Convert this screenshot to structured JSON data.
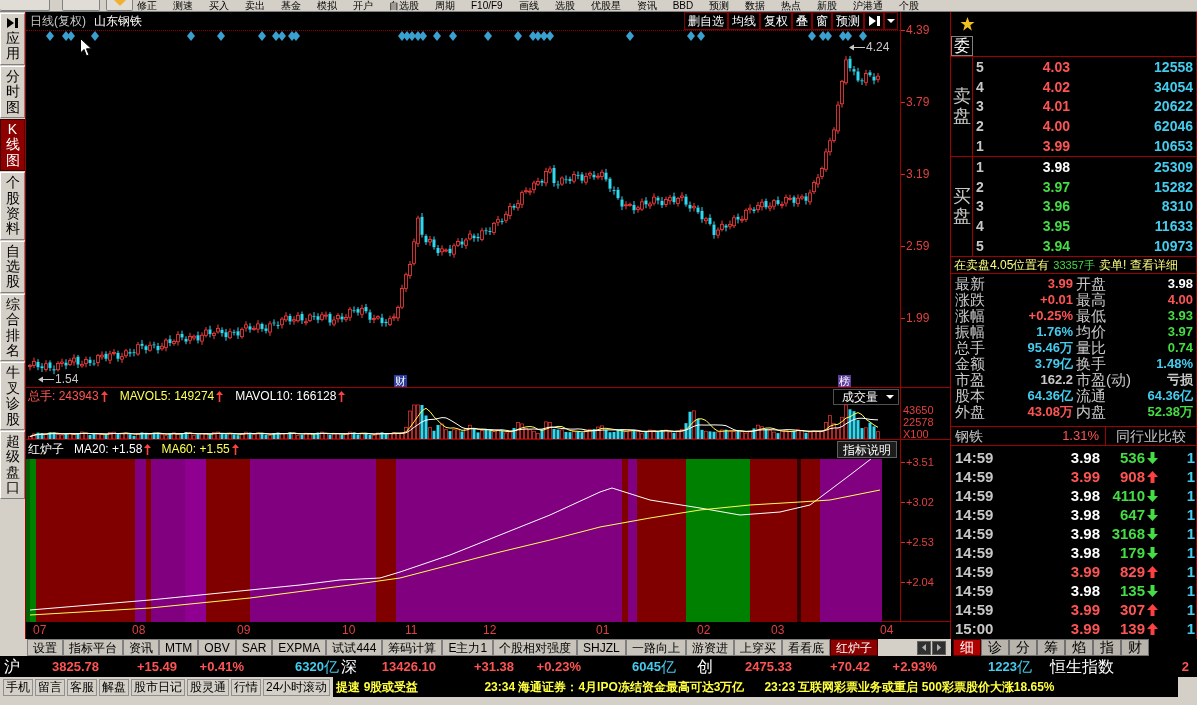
{
  "toolbar": {
    "items": [
      "修正",
      "测速",
      "买入",
      "卖出",
      "基金",
      "模拟",
      "开户",
      "自选股",
      "周期",
      "F10/F9",
      "画线",
      "选股",
      "优股星",
      "资讯",
      "BBD",
      "预测",
      "数据",
      "热点",
      "新股",
      "沪港通",
      "个股"
    ]
  },
  "side_tabs": [
    {
      "label": "应用",
      "kind": "toggle",
      "selected": false
    },
    {
      "label": "分时图",
      "kind": "page",
      "selected": false
    },
    {
      "label": "K线图",
      "kind": "page",
      "selected": true
    },
    {
      "label": "个股资料",
      "kind": "page",
      "selected": false
    },
    {
      "label": "自选股",
      "kind": "page",
      "selected": false
    },
    {
      "label": "综合排名",
      "kind": "page",
      "selected": false
    },
    {
      "label": "牛叉诊股",
      "kind": "page",
      "selected": false
    },
    {
      "label": "超级盘口",
      "kind": "page",
      "selected": false
    }
  ],
  "chart": {
    "period": "日线(复权)",
    "stock": "山东钢铁",
    "buttons": [
      "删自选",
      "均线",
      "复权",
      "叠",
      "窗",
      "预测"
    ],
    "price_axis": [
      "4.39",
      "3.79",
      "3.19",
      "2.59",
      "1.99"
    ],
    "high": "4.24",
    "low": "1.54",
    "events": [
      {
        "label": "财",
        "color": "#2a3c9c"
      },
      {
        "label": "榜",
        "color": "#5c3c9c"
      }
    ]
  },
  "volume": {
    "series": [
      {
        "text": "总手: 243943",
        "color": "#ff5454",
        "up": true
      },
      {
        "text": "MAVOL5: 149274",
        "color": "#ffff54",
        "up": true
      },
      {
        "text": "MAVOL10: 166128",
        "color": "#ffffff",
        "up": true
      }
    ],
    "selector": "成交量",
    "axis": [
      "43650",
      "22578",
      "X100"
    ]
  },
  "indicator": {
    "name": "红炉子",
    "series": [
      {
        "text": "MA20: +1.58",
        "color": "#ffffff",
        "up": true
      },
      {
        "text": "MA60: +1.55",
        "color": "#ffff54",
        "up": true
      }
    ],
    "help": "指标说明",
    "axis": [
      "+3.51",
      "+3.02",
      "+2.53",
      "+2.04"
    ]
  },
  "date_axis": [
    "07",
    "08",
    "09",
    "10",
    "11",
    "12",
    "01",
    "02",
    "03",
    "04"
  ],
  "indicator_tabs": [
    {
      "label": "设置",
      "selected": false
    },
    {
      "label": "指标平台",
      "selected": false
    },
    {
      "label": "资讯",
      "selected": false
    },
    {
      "label": "MTM",
      "selected": false
    },
    {
      "label": "OBV",
      "selected": false
    },
    {
      "label": "SAR",
      "selected": false
    },
    {
      "label": "EXPMA",
      "selected": false
    },
    {
      "label": "试试444",
      "selected": false
    },
    {
      "label": "筹码计算",
      "selected": false
    },
    {
      "label": "E主力1",
      "selected": false
    },
    {
      "label": "个股相对强度",
      "selected": false
    },
    {
      "label": "SHJZL",
      "selected": false
    },
    {
      "label": "一路向上",
      "selected": false
    },
    {
      "label": "游资进",
      "selected": false
    },
    {
      "label": "上穿买",
      "selected": false
    },
    {
      "label": "看看底",
      "selected": false
    },
    {
      "label": "红炉子",
      "selected": true
    }
  ],
  "quote": {
    "header": "委",
    "ask_label": "卖盘",
    "bid_label": "买盘",
    "asks": [
      {
        "level": "5",
        "price": "4.03",
        "color": "#ff5454",
        "volume": "12558"
      },
      {
        "level": "4",
        "price": "4.02",
        "color": "#ff5454",
        "volume": "34054"
      },
      {
        "level": "3",
        "price": "4.01",
        "color": "#ff5454",
        "volume": "20622"
      },
      {
        "level": "2",
        "price": "4.00",
        "color": "#ff5454",
        "volume": "62046"
      },
      {
        "level": "1",
        "price": "3.99",
        "color": "#ff5454",
        "volume": "10653"
      }
    ],
    "bids": [
      {
        "level": "1",
        "price": "3.98",
        "color": "#ffffff",
        "volume": "25309"
      },
      {
        "level": "2",
        "price": "3.97",
        "color": "#44dd44",
        "volume": "15282"
      },
      {
        "level": "3",
        "price": "3.96",
        "color": "#44dd44",
        "volume": "8310"
      },
      {
        "level": "4",
        "price": "3.95",
        "color": "#44dd44",
        "volume": "11633"
      },
      {
        "level": "5",
        "price": "3.94",
        "color": "#44dd44",
        "volume": "10973"
      }
    ]
  },
  "notice": {
    "text": "在卖盘4.05位置有",
    "amount": "33357手",
    "action": "卖单! 查看详细"
  },
  "stats": [
    {
      "label": "最新",
      "value": "3.99",
      "color": "#ff5454"
    },
    {
      "label": "开盘",
      "value": "3.98",
      "color": "#ffffff"
    },
    {
      "label": "涨跌",
      "value": "+0.01",
      "color": "#ff5454"
    },
    {
      "label": "最高",
      "value": "4.00",
      "color": "#ff5454"
    },
    {
      "label": "涨幅",
      "value": "+0.25%",
      "color": "#ff5454"
    },
    {
      "label": "最低",
      "value": "3.93",
      "color": "#44dd44"
    },
    {
      "label": "振幅",
      "value": "1.76%",
      "color": "#44ccee"
    },
    {
      "label": "均价",
      "value": "3.97",
      "color": "#44dd44"
    },
    {
      "label": "总手",
      "value": "95.46万",
      "color": "#44ccee"
    },
    {
      "label": "量比",
      "value": "0.74",
      "color": "#44dd44"
    },
    {
      "label": "金额",
      "value": "3.79亿",
      "color": "#44ccee"
    },
    {
      "label": "换手",
      "value": "1.48%",
      "color": "#44ccee"
    },
    {
      "label": "市盈",
      "value": "162.2",
      "color": "#c8c8c8"
    },
    {
      "label": "市盈(动)",
      "value": "亏损",
      "color": "#c8c8c8"
    },
    {
      "label": "股本",
      "value": "64.36亿",
      "color": "#44ccee"
    },
    {
      "label": "流通",
      "value": "64.36亿",
      "color": "#44ccee"
    },
    {
      "label": "外盘",
      "value": "43.08万",
      "color": "#ff5454"
    },
    {
      "label": "内盘",
      "value": "52.38万",
      "color": "#44dd44"
    }
  ],
  "industry": {
    "name": "钢铁",
    "change": "1.31%",
    "button": "同行业比较"
  },
  "ticks": [
    {
      "time": "14:59",
      "price": "3.98",
      "color": "#ffffff",
      "volume": "536",
      "up": false,
      "column_4": "1"
    },
    {
      "time": "14:59",
      "price": "3.99",
      "color": "#ff5454",
      "volume": "908",
      "up": true,
      "column_4": "1"
    },
    {
      "time": "14:59",
      "price": "3.98",
      "color": "#ffffff",
      "volume": "4110",
      "up": false,
      "column_4": "1"
    },
    {
      "time": "14:59",
      "price": "3.98",
      "color": "#ffffff",
      "volume": "647",
      "up": false,
      "column_4": "1"
    },
    {
      "time": "14:59",
      "price": "3.98",
      "color": "#ffffff",
      "volume": "3168",
      "up": false,
      "column_4": "1"
    },
    {
      "time": "14:59",
      "price": "3.98",
      "color": "#ffffff",
      "volume": "179",
      "up": false,
      "column_4": "1"
    },
    {
      "time": "14:59",
      "price": "3.99",
      "color": "#ff5454",
      "volume": "829",
      "up": true,
      "column_4": "1"
    },
    {
      "time": "14:59",
      "price": "3.98",
      "color": "#ffffff",
      "volume": "135",
      "up": false,
      "column_4": "1"
    },
    {
      "time": "14:59",
      "price": "3.99",
      "color": "#ff5454",
      "volume": "307",
      "up": true,
      "column_4": "1"
    },
    {
      "time": "15:00",
      "price": "3.99",
      "color": "#ff5454",
      "volume": "139",
      "up": true,
      "column_4": "1"
    }
  ],
  "detail_tabs": [
    {
      "label": "细",
      "selected": true
    },
    {
      "label": "诊",
      "selected": false
    },
    {
      "label": "分",
      "selected": false
    },
    {
      "label": "筹",
      "selected": false
    },
    {
      "label": "焰",
      "selected": false
    },
    {
      "label": "指",
      "selected": false
    },
    {
      "label": "财",
      "selected": false
    }
  ],
  "indices": [
    {
      "name": "沪",
      "value": "3825.78",
      "change": "+15.49",
      "percent": "+0.41%",
      "amount": "6320",
      "unit": "亿"
    },
    {
      "name": "深",
      "value": "13426.10",
      "change": "+31.38",
      "percent": "+0.23%",
      "amount": "6045",
      "unit": "亿"
    },
    {
      "name": "创",
      "value": "2475.33",
      "change": "+70.42",
      "percent": "+2.93%",
      "amount": "1223",
      "unit": "亿"
    },
    {
      "name": "恒生指数",
      "value": "2"
    }
  ],
  "status_bar": {
    "links": [
      "手机",
      "留言",
      "客服",
      "解盘",
      "股市日记",
      "股灵通",
      "行情",
      "24小时滚动"
    ],
    "news": [
      "提速 9股或受益",
      "23:34 海通证券：4月IPO冻结资金最高可达3万亿",
      "23:23 互联网彩票业务或重启 500彩票股价大涨18.65%"
    ]
  }
}
